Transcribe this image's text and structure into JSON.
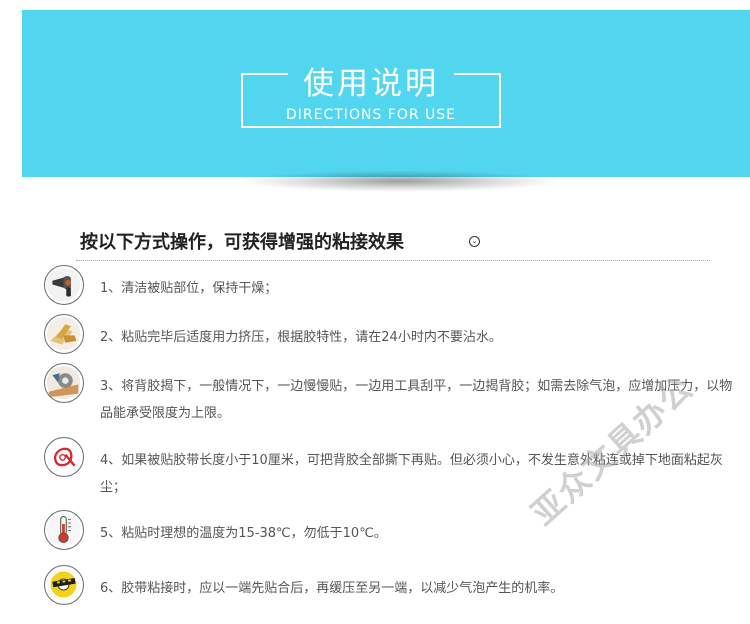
{
  "banner": {
    "title_cn": "使用说明",
    "title_en": "DIRECTIONS FOR USE",
    "background": "#52d6ef"
  },
  "heading": {
    "text": "按以下方式操作，可获得增强的粘接效果",
    "marker_icon": "circle-down-icon"
  },
  "steps": [
    {
      "icon": "hair-dryer-icon",
      "text": "1、清洁被贴部位，保持干燥；"
    },
    {
      "icon": "pressing-hand-icon",
      "text": "2、粘贴完毕后适度用力挤压，根据胶特性，请在24小时内不要沾水。"
    },
    {
      "icon": "tape-roll-peel-icon",
      "text": "3、将背胶揭下，一般情况下，一边慢慢贴，一边用工具刮平，一边揭背胶；如需去除气泡，应增加压力，以物品能承受限度为上限。"
    },
    {
      "icon": "red-tape-icon",
      "text": "4、如果被贴胶带长度小于10厘米，可把背胶全部撕下再贴。但必须小心，不发生意外粘连或掉下地面粘起灰尘；"
    },
    {
      "icon": "thermometer-icon",
      "text": "5、粘贴时理想的温度为15-38℃，勿低于10℃。"
    },
    {
      "icon": "yellow-tape-roll-icon",
      "text": "6、胶带粘接时，应以一端先贴合后，再缓压至另一端，以减少气泡产生的机率。"
    }
  ],
  "watermark": "亚众文具办公"
}
